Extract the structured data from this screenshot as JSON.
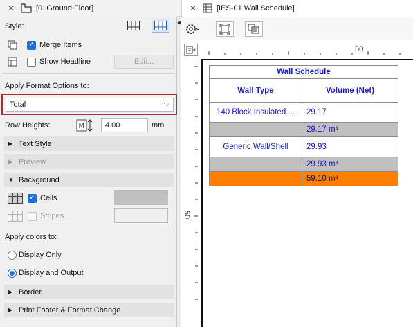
{
  "tabs": {
    "left": {
      "label": "[0. Ground Floor]"
    },
    "right": {
      "label": "[IES-01 Wall Schedule]"
    }
  },
  "panel": {
    "style_label": "Style:",
    "merge_items": {
      "label": "Merge Items",
      "checked": true
    },
    "show_headline": {
      "label": "Show Headline",
      "checked": false
    },
    "edit_button": "Edit...",
    "apply_format_label": "Apply Format Options to:",
    "apply_format_value": "Total",
    "row_heights_label": "Row Heights:",
    "row_heights_value": "4.00",
    "row_heights_unit": "mm",
    "sections": {
      "text_style": "Text Style",
      "preview": "Preview",
      "background": "Background",
      "border": "Border",
      "print_footer": "Print Footer & Format Change"
    },
    "cells": {
      "label": "Cells",
      "checked": true
    },
    "stripes": {
      "label": "Stripes",
      "checked": false
    },
    "apply_colors_label": "Apply colors to:",
    "display_only": "Display Only",
    "display_and_output": "Display and Output",
    "colors": {
      "cells_swatch": "#c0c0c0",
      "stripes_swatch": "#f0f0f0",
      "highlight": "#b3272d"
    }
  },
  "view": {
    "ruler": {
      "top_mark": "50",
      "left_mark": "50"
    },
    "schedule": {
      "title": "Wall Schedule",
      "headers": [
        "Wall Type",
        "Volume (Net)"
      ],
      "rows": [
        {
          "type": "140 Block Insulated ...",
          "volume": "29.17",
          "style": "white"
        },
        {
          "type": "",
          "volume": "29.17 m³",
          "style": "gray"
        },
        {
          "type": "Generic Wall/Shell",
          "volume": "29.93",
          "style": "white"
        },
        {
          "type": "",
          "volume": "29.93 m³",
          "style": "gray"
        },
        {
          "type": "",
          "volume": "59.10 m³",
          "style": "orange"
        }
      ],
      "colors": {
        "text": "#1a1ad0",
        "subtotal": "#c0c0c0",
        "total": "#ff7f00"
      }
    }
  }
}
